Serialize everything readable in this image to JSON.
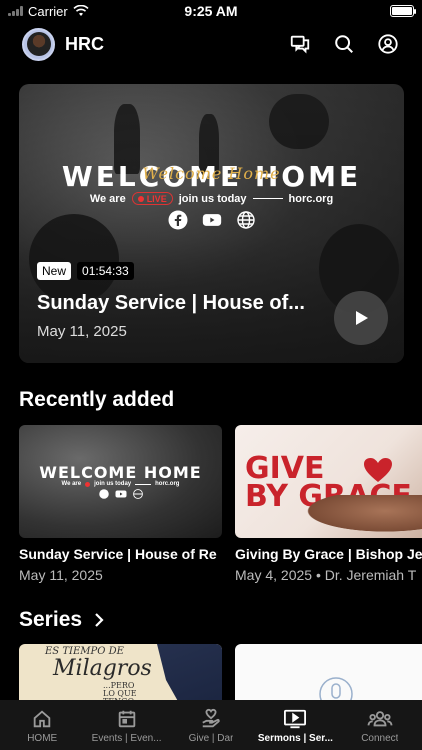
{
  "status_bar": {
    "carrier": "Carrier",
    "time": "9:25 AM"
  },
  "header": {
    "app_name": "HRC"
  },
  "hero": {
    "graphic_title": "WELCOME HOME",
    "graphic_script": "Welcome Home",
    "graphic_line_left": "We are",
    "live_label": "LIVE",
    "graphic_line_mid": "join us today",
    "graphic_url": "horc.org",
    "badge": "New",
    "duration": "01:54:33",
    "title": "Sunday Service | House of...",
    "date": "May 11, 2025"
  },
  "recently_added": {
    "heading": "Recently added",
    "items": [
      {
        "title": "Sunday Service | House of Re",
        "subtitle": "May 11, 2025",
        "art_title": "WELCOME HOME",
        "art_line_left": "We are",
        "art_line_mid": "join us today",
        "art_url": "horc.org"
      },
      {
        "title": "Giving By Grace | Bishop Je",
        "subtitle": "May 4, 2025 • Dr. Jeremiah T",
        "art_line1": "GIVE",
        "art_line2": "BY GRACE"
      }
    ]
  },
  "series": {
    "heading": "Series",
    "items": [
      {
        "art_script": "ES TIEMPO DE",
        "art_big": "Milagros",
        "art_small": "...PERO LO QUE TENGO TE DOY..."
      },
      {
        "art_icon": "microphone-icon"
      }
    ]
  },
  "tabbar": {
    "tabs": [
      {
        "label": "HOME",
        "icon": "home-icon",
        "active": false
      },
      {
        "label": "Events | Even...",
        "icon": "calendar-icon",
        "active": false
      },
      {
        "label": "Give | Dar",
        "icon": "give-hand-icon",
        "active": false
      },
      {
        "label": "Sermons | Ser...",
        "icon": "play-screen-icon",
        "active": true
      },
      {
        "label": "Connect",
        "icon": "people-icon",
        "active": false
      }
    ]
  },
  "colors": {
    "background": "#000000",
    "tabbar": "#161616",
    "accent_gold": "#e1b04a",
    "live_red": "#e33333",
    "give_red": "#c9232b"
  }
}
